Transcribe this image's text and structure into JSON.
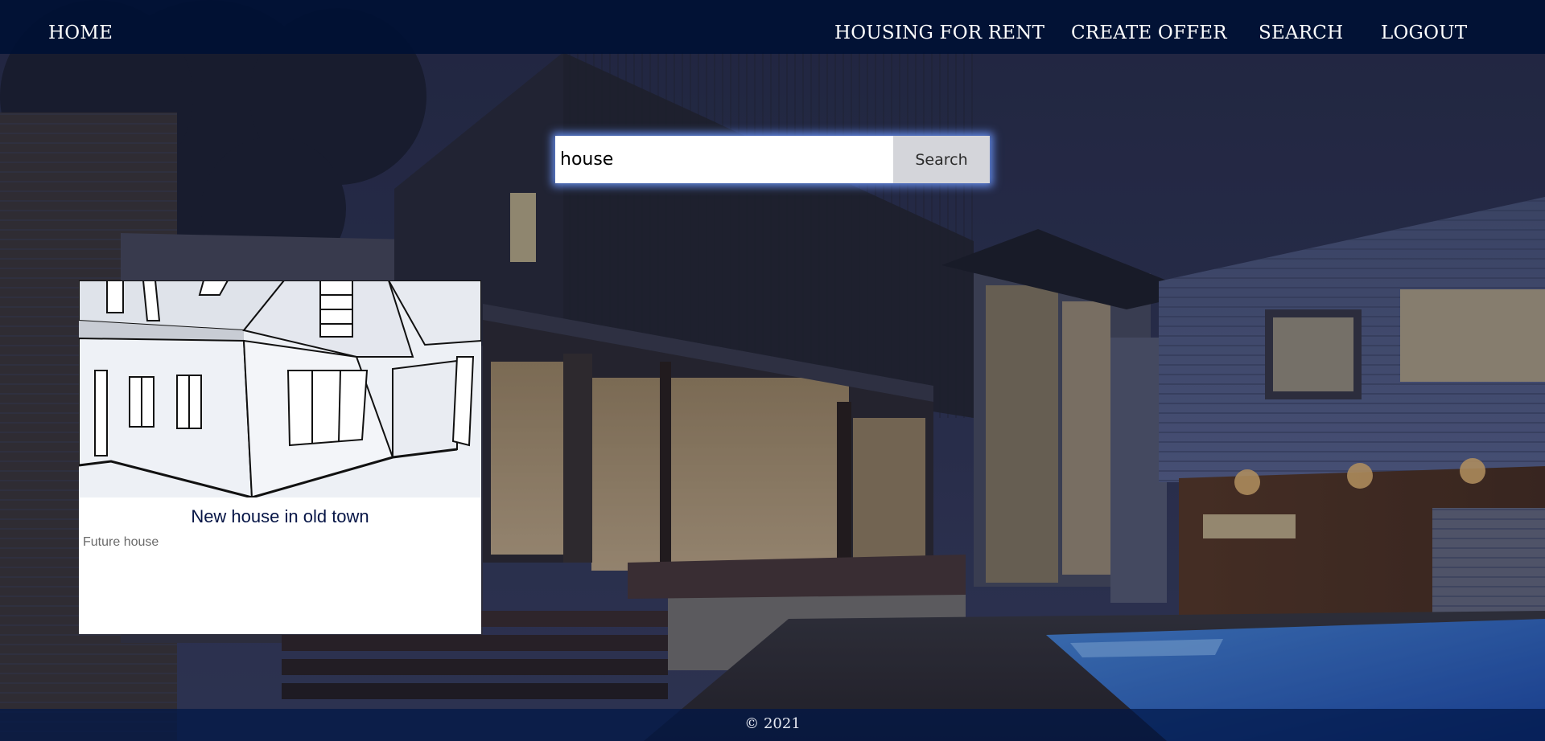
{
  "nav": {
    "home": "HOME",
    "housing_for_rent": "HOUSING FOR RENT",
    "create_offer": "CREATE OFFER",
    "search": "SEARCH",
    "logout": "LOGOUT"
  },
  "search": {
    "value": "house",
    "button_label": "Search"
  },
  "results": [
    {
      "title": "New house in old town",
      "description": "Future house",
      "image_icon": "house-sketch-icon"
    }
  ],
  "footer": {
    "copyright": "© 2021"
  },
  "colors": {
    "navbar_bg": "#001034",
    "search_glow": "#6c98ff",
    "card_title": "#061546",
    "footer_bg": "#001646"
  },
  "background_icon": "night-modern-house-photo"
}
